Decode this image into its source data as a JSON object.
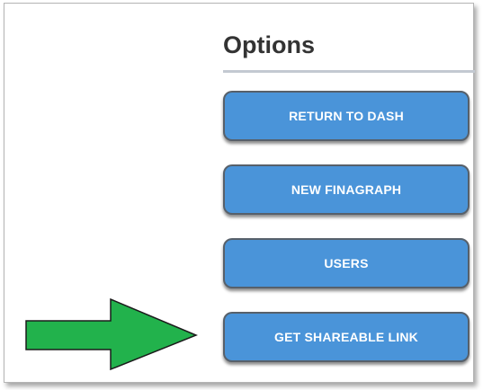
{
  "options": {
    "title": "Options",
    "buttons": [
      {
        "label": "RETURN TO DASH"
      },
      {
        "label": "NEW FINAGRAPH"
      },
      {
        "label": "USERS"
      },
      {
        "label": "GET SHAREABLE LINK"
      }
    ]
  },
  "colors": {
    "button_fill": "#4a94d9",
    "button_border": "#57606a",
    "arrow_fill": "#22b24c",
    "title_text": "#333333",
    "divider": "#c3c9d1"
  },
  "annotation": {
    "icon": "right-arrow-icon"
  }
}
